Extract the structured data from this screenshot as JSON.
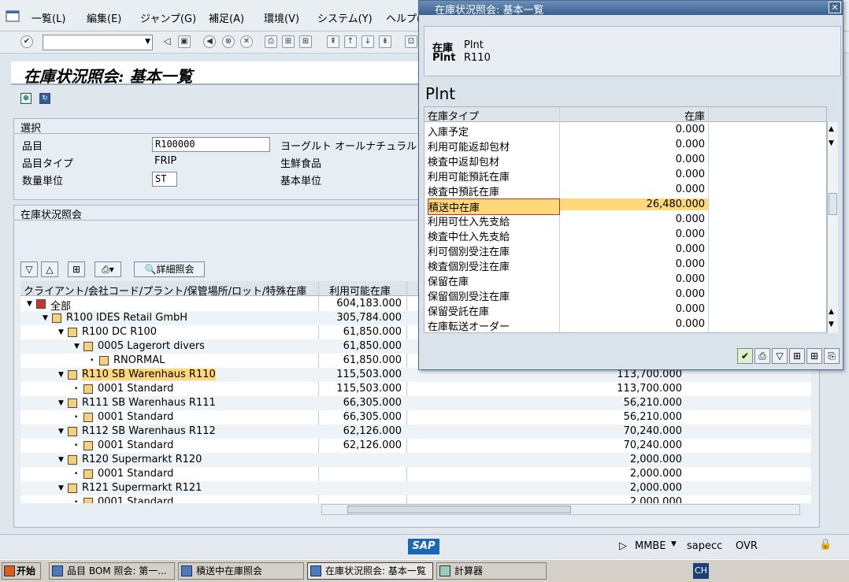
{
  "menu": {
    "items": [
      "一覧(L)",
      "編集(E)",
      "ジャンプ(G)",
      "補足(A)",
      "環境(V)",
      "システム(Y)",
      "ヘルプ("
    ]
  },
  "page": {
    "title": "在庫状況照会: 基本一覧"
  },
  "selection": {
    "frame_title": "選択",
    "material_label": "品目",
    "material_value": "R100000",
    "material_desc": "ヨーグルト オールナチュラル",
    "material_type_label": "品目タイプ",
    "material_type_value": "FRIP",
    "material_type_desc": "生鮮食品",
    "unit_label": "数量単位",
    "unit_value": "ST",
    "base_unit_label": "基本単位"
  },
  "stock_overview": {
    "frame_title": "在庫状況照会",
    "detail_button": "詳細照会",
    "columns": [
      "クライアント/会社コード/プラント/保管場所/ロット/特殊在庫",
      "利用可能在庫"
    ],
    "rows": [
      {
        "name": "全部",
        "avail": "604,183.000",
        "other": ""
      },
      {
        "name": "R100 IDES Retail GmbH",
        "avail": "305,784.000",
        "other": ""
      },
      {
        "name": "R100 DC R100",
        "avail": "61,850.000",
        "other": ""
      },
      {
        "name": "0005 Lagerort divers",
        "avail": "61,850.000",
        "other": ""
      },
      {
        "name": "RNORMAL",
        "avail": "61,850.000",
        "other": ""
      },
      {
        "name": "R110 SB Warenhaus R110",
        "avail": "115,503.000",
        "other": "113,700.000"
      },
      {
        "name": "0001 Standard",
        "avail": "115,503.000",
        "other": "113,700.000"
      },
      {
        "name": "R111 SB Warenhaus R111",
        "avail": "66,305.000",
        "other": "56,210.000"
      },
      {
        "name": "0001 Standard",
        "avail": "66,305.000",
        "other": "56,210.000"
      },
      {
        "name": "R112 SB Warenhaus R112",
        "avail": "62,126.000",
        "other": "70,240.000"
      },
      {
        "name": "0001 Standard",
        "avail": "62,126.000",
        "other": "70,240.000"
      },
      {
        "name": "R120 Supermarkt R120",
        "avail": "",
        "other": "2,000.000"
      },
      {
        "name": "0001 Standard",
        "avail": "",
        "other": "2,000.000"
      },
      {
        "name": "R121 Supermarkt R121",
        "avail": "",
        "other": "2,000.000"
      },
      {
        "name": "0001 Standard",
        "avail": "",
        "other": "2,000.000"
      }
    ]
  },
  "popup": {
    "title": "在庫状況照会: 基本一覧",
    "plant_label": "在庫",
    "plant_value": "Plnt",
    "plnt_label": "Plnt",
    "plnt_value": "R110",
    "heading": "Plnt",
    "col_type": "在庫タイプ",
    "col_stock": "在庫",
    "rows": [
      {
        "type": "入庫予定",
        "stock": "0.000"
      },
      {
        "type": "利用可能返却包材",
        "stock": "0.000"
      },
      {
        "type": "検査中返却包材",
        "stock": "0.000"
      },
      {
        "type": "利用可能預託在庫",
        "stock": "0.000"
      },
      {
        "type": "検査中預託在庫",
        "stock": "0.000"
      },
      {
        "type": "積送中在庫",
        "stock": "26,480.000"
      },
      {
        "type": "利用可仕入先支給",
        "stock": "0.000"
      },
      {
        "type": "検査中仕入先支給",
        "stock": "0.000"
      },
      {
        "type": "利可個別受注在庫",
        "stock": "0.000"
      },
      {
        "type": "検査個別受注在庫",
        "stock": "0.000"
      },
      {
        "type": "保留在庫",
        "stock": "0.000"
      },
      {
        "type": "保留個別受注在庫",
        "stock": "0.000"
      },
      {
        "type": "保留受託在庫",
        "stock": "0.000"
      },
      {
        "type": "在庫転送オーダー",
        "stock": "0.000"
      }
    ]
  },
  "status": {
    "tcode": "MMBE",
    "server": "sapecc",
    "mode": "OVR",
    "sap_logo": "SAP"
  },
  "taskbar": {
    "start": "开始",
    "tasks": [
      "品目 BOM 照会: 第一...",
      "積送中在庫照会",
      "在庫状況照会: 基本一覧",
      "計算器"
    ],
    "tray_lang": "CH"
  }
}
